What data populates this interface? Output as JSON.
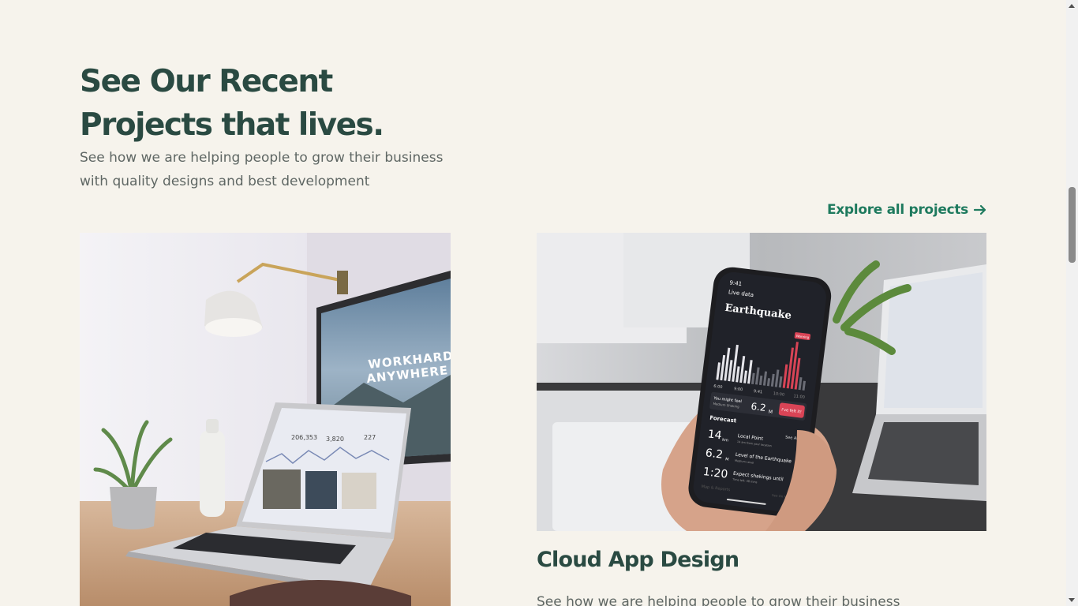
{
  "section": {
    "heading_lines": [
      "See Our Recent",
      "Projects that lives."
    ],
    "subtitle_lines": [
      "See how we are helping people to grow their business",
      "with quality designs and best development"
    ],
    "explore_label": "Explore all projects"
  },
  "projects": [
    {
      "image_desc": "desk-workspace-photo",
      "screen": {
        "poster_line1": "WORKHARD",
        "poster_line2": "ANYWHERE",
        "stats": [
          "206,353",
          "3,820",
          "227"
        ]
      }
    },
    {
      "image_desc": "phone-earthquake-app-photo",
      "title": "Cloud App Design",
      "description": "See how we are helping people to grow their business",
      "phone": {
        "time": "9:41",
        "back_label": "Live data",
        "app_title": "Earthquake",
        "flag": "Warning",
        "axis_times": [
          "6:00",
          "9:00",
          "9:41",
          "10:00",
          "11:00"
        ],
        "feel_label": "You might feel",
        "feel_sub": "Medium Shaking",
        "feel_value": "6.2",
        "feel_unit": "M",
        "felt_button": "I've felt it!",
        "forecast_label": "Forecast",
        "see_all": "See All",
        "rows": [
          {
            "value": "14",
            "unit": "km",
            "label": "Local Point",
            "sub": "14 km from your location"
          },
          {
            "value": "6.2",
            "unit": "M",
            "label": "Level of the Earthquake",
            "sub": "Medium Level"
          },
          {
            "value": "1:20",
            "unit": "",
            "label": "Expect shakings until",
            "sub": "Time left: 38 mins"
          }
        ],
        "footer_left": "Map & Reports",
        "footer_right": "See On Map"
      }
    }
  ],
  "colors": {
    "background": "#f6f3ec",
    "heading": "#2a4a42",
    "body_text": "#5f6764",
    "accent_link": "#1e7a5e",
    "phone_alert": "#d94456"
  }
}
